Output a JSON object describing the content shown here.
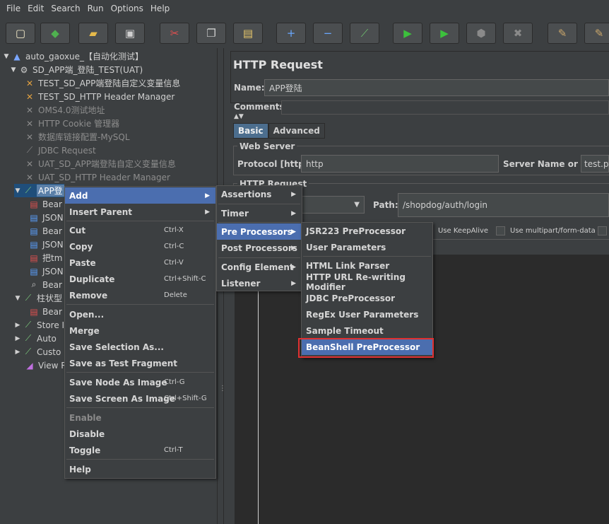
{
  "menubar": [
    "File",
    "Edit",
    "Search",
    "Run",
    "Options",
    "Help"
  ],
  "toolbar": [
    {
      "icon": "new-icon",
      "glyph": "▢",
      "color": "#f2e9c8"
    },
    {
      "icon": "templates-icon",
      "glyph": "◆",
      "color": "#4fb04f"
    },
    {
      "icon": "open-icon",
      "glyph": "▰",
      "color": "#e5b94a"
    },
    {
      "icon": "save-icon",
      "glyph": "▣",
      "color": "#cfcfcf"
    },
    {
      "icon": "cut-icon",
      "glyph": "✂",
      "color": "#e34f4f"
    },
    {
      "icon": "copy-icon",
      "glyph": "❐",
      "color": "#d0d0d0"
    },
    {
      "icon": "paste-icon",
      "glyph": "▤",
      "color": "#e5c56a"
    },
    {
      "icon": "expand-icon",
      "glyph": "+",
      "color": "#6aa8ff"
    },
    {
      "icon": "collapse-icon",
      "glyph": "−",
      "color": "#6aa8ff"
    },
    {
      "icon": "toggle-icon",
      "glyph": "⟋",
      "color": "#6fc06f"
    },
    {
      "icon": "start-icon",
      "glyph": "▶",
      "color": "#3cc13c"
    },
    {
      "icon": "start-no-pause-icon",
      "glyph": "▶",
      "color": "#3cc13c"
    },
    {
      "icon": "stop-icon",
      "glyph": "⬢",
      "color": "#8a8a8a"
    },
    {
      "icon": "shutdown-icon",
      "glyph": "✖",
      "color": "#8a8a8a"
    },
    {
      "icon": "clear-icon",
      "glyph": "✎",
      "color": "#c9a66b"
    },
    {
      "icon": "clear-all-icon",
      "glyph": "✎",
      "color": "#c9a66b"
    }
  ],
  "tree": [
    {
      "label": "auto_gaoxue_【自动化测试】",
      "icon": "testplan-icon",
      "glyph": "▲",
      "color": "#7aa6ff",
      "twisty": "▼",
      "dim": false
    },
    {
      "label": "SD_APP端_登陆_TEST(UAT)",
      "icon": "thread-group-icon",
      "glyph": "⚙",
      "color": "#cfcfcf",
      "twisty": "▼",
      "dim": false
    },
    {
      "label": "TEST_SD_APP端登陆自定义变量信息",
      "icon": "config-icon",
      "glyph": "✕",
      "color": "#e0a040",
      "twisty": "",
      "dim": false
    },
    {
      "label": "TEST_SD_HTTP Header Manager",
      "icon": "config-icon",
      "glyph": "✕",
      "color": "#e0a040",
      "twisty": "",
      "dim": false
    },
    {
      "label": "OMS4.0测试地址",
      "icon": "config-icon",
      "glyph": "✕",
      "color": "#8a8a8a",
      "twisty": "",
      "dim": true
    },
    {
      "label": "HTTP Cookie 管理器",
      "icon": "config-icon",
      "glyph": "✕",
      "color": "#8a8a8a",
      "twisty": "",
      "dim": true
    },
    {
      "label": "数据库链接配置-MySQL",
      "icon": "config-icon",
      "glyph": "✕",
      "color": "#8a8a8a",
      "twisty": "",
      "dim": true
    },
    {
      "label": "JDBC Request",
      "icon": "sampler-icon",
      "glyph": "⟋",
      "color": "#8a8a8a",
      "twisty": "",
      "dim": true
    },
    {
      "label": "UAT_SD_APP端登陆自定义变量信息",
      "icon": "config-icon",
      "glyph": "✕",
      "color": "#8a8a8a",
      "twisty": "",
      "dim": true
    },
    {
      "label": "UAT_SD_HTTP Header Manager",
      "icon": "config-icon",
      "glyph": "✕",
      "color": "#8a8a8a",
      "twisty": "",
      "dim": true
    },
    {
      "label": "APP登",
      "icon": "sampler-icon",
      "glyph": "⟋",
      "color": "#7ecf7e",
      "twisty": "▼",
      "dim": false,
      "selected": true
    },
    {
      "label": "Bear",
      "icon": "beanshell-icon",
      "glyph": "▤",
      "color": "#e05050",
      "twisty": "",
      "dim": false
    },
    {
      "label": "JSON",
      "icon": "extractor-icon",
      "glyph": "▤",
      "color": "#5aa0ff",
      "twisty": "",
      "dim": false
    },
    {
      "label": "Bear",
      "icon": "beanshell-icon",
      "glyph": "▤",
      "color": "#5aa0ff",
      "twisty": "",
      "dim": false
    },
    {
      "label": "JSON",
      "icon": "extractor-icon",
      "glyph": "▤",
      "color": "#5aa0ff",
      "twisty": "",
      "dim": false
    },
    {
      "label": "把tm",
      "icon": "processor-icon",
      "glyph": "▤",
      "color": "#e05050",
      "twisty": "",
      "dim": false
    },
    {
      "label": "JSON",
      "icon": "extractor-icon",
      "glyph": "▤",
      "color": "#5aa0ff",
      "twisty": "",
      "dim": false
    },
    {
      "label": "Bear",
      "icon": "listener-icon",
      "glyph": "⌕",
      "color": "#cfcfcf",
      "twisty": "",
      "dim": false
    },
    {
      "label": "柱状型",
      "icon": "sampler-icon",
      "glyph": "⟋",
      "color": "#7ecf7e",
      "twisty": "▼",
      "dim": false
    },
    {
      "label": "Bear",
      "icon": "beanshell-icon",
      "glyph": "▤",
      "color": "#e05050",
      "twisty": "",
      "dim": false
    },
    {
      "label": "Store I",
      "icon": "sampler-icon",
      "glyph": "⟋",
      "color": "#7ecf7e",
      "twisty": "▶",
      "dim": false
    },
    {
      "label": "Auto",
      "icon": "sampler-icon",
      "glyph": "⟋",
      "color": "#7ecf7e",
      "twisty": "▶",
      "dim": false
    },
    {
      "label": "Custo",
      "icon": "sampler-icon",
      "glyph": "⟋",
      "color": "#7ecf7e",
      "twisty": "▶",
      "dim": false
    },
    {
      "label": "View R",
      "icon": "graph-icon",
      "glyph": "◢",
      "color": "#c070e0",
      "twisty": "",
      "dim": false
    }
  ],
  "panel": {
    "title": "HTTP Request",
    "name_label": "Name:",
    "name_value": "APP登陆",
    "comments_label": "Comments:",
    "tabs": [
      "Basic",
      "Advanced"
    ],
    "web_server_title": "Web Server",
    "protocol_label": "Protocol [http]:",
    "protocol_value": "http",
    "server_label": "Server Name or IP:",
    "server_value": "test.pt",
    "http_request_title": "HTTP Request",
    "path_label": "Path:",
    "path_value": "/shopdog/auth/login",
    "keepalive_label": "Use KeepAlive",
    "multipart_label": "Use multipart/form-data"
  },
  "context_menu": [
    {
      "label": "Add",
      "submenu": true,
      "highlight": true
    },
    {
      "label": "Insert Parent",
      "submenu": true
    },
    {
      "sep": true
    },
    {
      "label": "Cut",
      "acc": "Ctrl-X"
    },
    {
      "label": "Copy",
      "acc": "Ctrl-C"
    },
    {
      "label": "Paste",
      "acc": "Ctrl-V"
    },
    {
      "label": "Duplicate",
      "acc": "Ctrl+Shift-C"
    },
    {
      "label": "Remove",
      "acc": "Delete"
    },
    {
      "sep": true
    },
    {
      "label": "Open..."
    },
    {
      "label": "Merge"
    },
    {
      "label": "Save Selection As..."
    },
    {
      "label": "Save as Test Fragment"
    },
    {
      "sep": true
    },
    {
      "label": "Save Node As Image",
      "acc": "Ctrl-G"
    },
    {
      "label": "Save Screen As Image",
      "acc": "Ctrl+Shift-G"
    },
    {
      "sep": true
    },
    {
      "label": "Enable",
      "disabled": true
    },
    {
      "label": "Disable"
    },
    {
      "label": "Toggle",
      "acc": "Ctrl-T"
    },
    {
      "sep": true
    },
    {
      "label": "Help"
    }
  ],
  "add_submenu": [
    {
      "label": "Assertions",
      "submenu": true
    },
    {
      "sep": true
    },
    {
      "label": "Timer",
      "submenu": true
    },
    {
      "sep": true
    },
    {
      "label": "Pre Processors",
      "submenu": true,
      "highlight": true
    },
    {
      "label": "Post Processors",
      "submenu": true
    },
    {
      "sep": true
    },
    {
      "label": "Config Element",
      "submenu": true
    },
    {
      "label": "Listener",
      "submenu": true
    }
  ],
  "pre_submenu": [
    {
      "label": "JSR223 PreProcessor"
    },
    {
      "label": "User Parameters"
    },
    {
      "sep": true
    },
    {
      "label": "HTML Link Parser"
    },
    {
      "label": "HTTP URL Re-writing Modifier"
    },
    {
      "label": "JDBC PreProcessor"
    },
    {
      "label": "RegEx User Parameters"
    },
    {
      "label": "Sample Timeout"
    },
    {
      "label": "BeanShell PreProcessor",
      "highlight": true
    }
  ]
}
